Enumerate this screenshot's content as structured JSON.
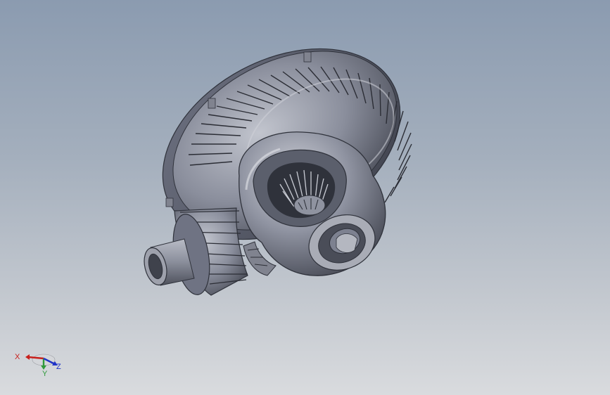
{
  "viewport": {
    "model": {
      "icon": "differential-gear-assembly",
      "color_body": "#7f8393",
      "color_dark": "#3d404b",
      "color_light": "#b9bcc6"
    },
    "triad": {
      "x_label": "X",
      "y_label": "Y",
      "z_label": "Z",
      "x_color": "#c8201c",
      "y_color": "#2f9a3a",
      "z_color": "#1f33c8"
    }
  }
}
